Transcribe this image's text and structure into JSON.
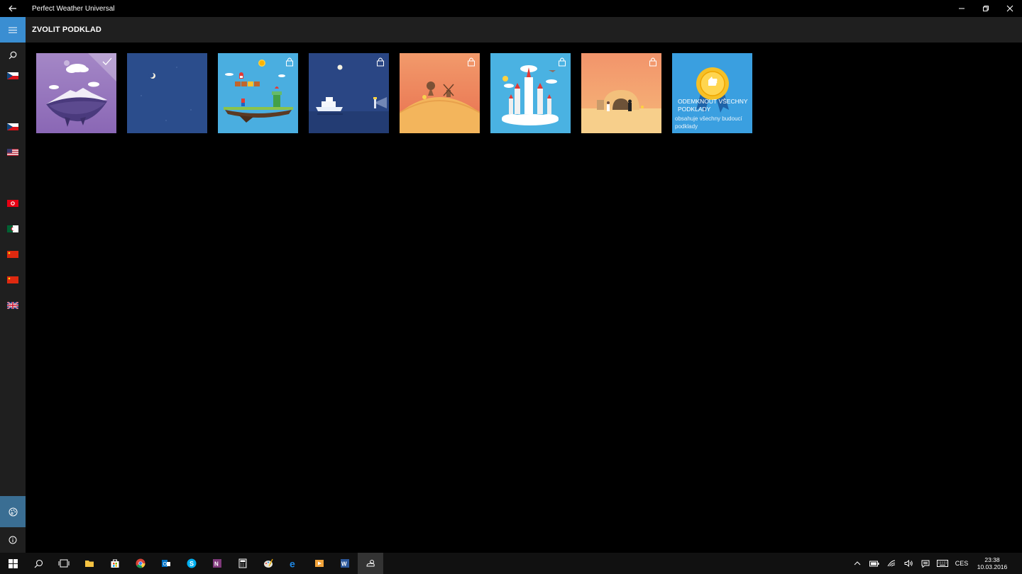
{
  "window": {
    "title": "Perfect Weather Universal"
  },
  "header": {
    "title": "ZVOLIT PODKLAD"
  },
  "sidebar": {
    "flags": [
      "Czech Republic",
      "Czech Republic",
      "United States",
      "Tunisia",
      "Algeria",
      "China",
      "China",
      "United Kingdom"
    ]
  },
  "backgrounds": {
    "tiles": [
      {
        "name": "floating-island",
        "selected": true,
        "locked": false,
        "color": "#8e6bb7"
      },
      {
        "name": "night-sky",
        "selected": false,
        "locked": false,
        "color": "#2b4d8c"
      },
      {
        "name": "platformer",
        "selected": false,
        "locked": true,
        "color": "#4aaee0"
      },
      {
        "name": "night-sea",
        "selected": false,
        "locked": true,
        "color": "#2a4684"
      },
      {
        "name": "desert-windmill",
        "selected": false,
        "locked": true,
        "color": "#ef8a5a"
      },
      {
        "name": "castle",
        "selected": false,
        "locked": true,
        "color": "#4ab2e2"
      },
      {
        "name": "desert-hut",
        "selected": false,
        "locked": true,
        "color": "#f3a870"
      }
    ],
    "unlock_all": {
      "title": "ODEMK… VŠECHNY PODKLADY",
      "title_line1": "ODEMKNOUT VŠECHNY",
      "title_line2": "PODKLADY",
      "subtitle": "obsahuje všechny budoucí podklady",
      "color": "#3a9fe0"
    }
  },
  "taskbar": {
    "language": "CES",
    "time": "23:38",
    "date": "10.03.2016"
  },
  "colors": {
    "accent": "#3a8ed2",
    "sidebar": "#1f1f1f",
    "selected_nav": "#3a6e93"
  }
}
